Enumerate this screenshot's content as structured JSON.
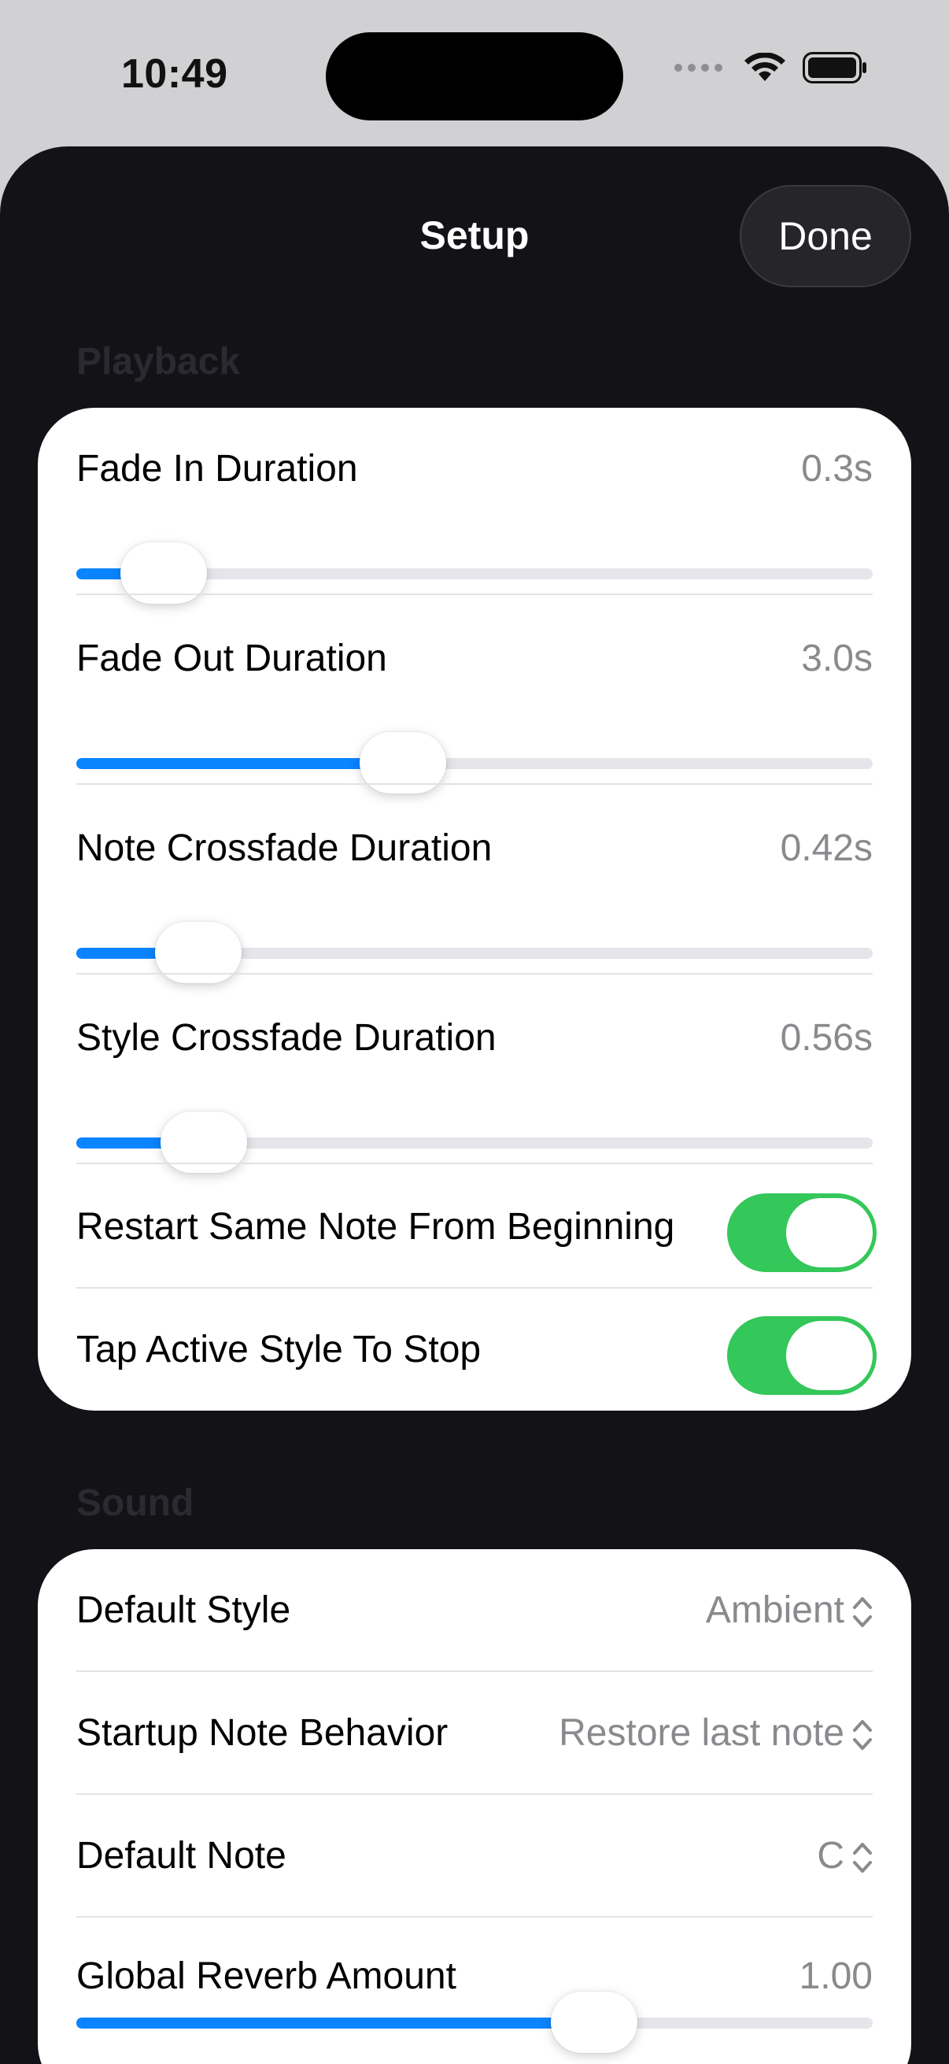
{
  "status_bar": {
    "time": "10:49"
  },
  "sheet": {
    "title": "Setup",
    "done_label": "Done"
  },
  "playback": {
    "header": "Playback",
    "sliders": [
      {
        "label": "Fade In Duration",
        "value": "0.3s",
        "fraction": 0.11
      },
      {
        "label": "Fade Out Duration",
        "value": "3.0s",
        "fraction": 0.41
      },
      {
        "label": "Note Crossfade Duration",
        "value": "0.42s",
        "fraction": 0.153
      },
      {
        "label": "Style Crossfade Duration",
        "value": "0.56s",
        "fraction": 0.16
      }
    ],
    "toggles": [
      {
        "label": "Restart Same Note From Beginning",
        "on": true
      },
      {
        "label": "Tap Active Style To Stop",
        "on": true
      }
    ]
  },
  "sound": {
    "header": "Sound",
    "pickers": [
      {
        "label": "Default Style",
        "value": "Ambient"
      },
      {
        "label": "Startup Note Behavior",
        "value": "Restore last note"
      },
      {
        "label": "Default Note",
        "value": "C"
      }
    ],
    "reverb": {
      "label": "Global Reverb Amount",
      "value": "1.00",
      "fraction": 0.65
    }
  },
  "colors": {
    "accent": "#0a84ff",
    "toggle_on": "#34c759",
    "sheet_bg": "#121217"
  }
}
